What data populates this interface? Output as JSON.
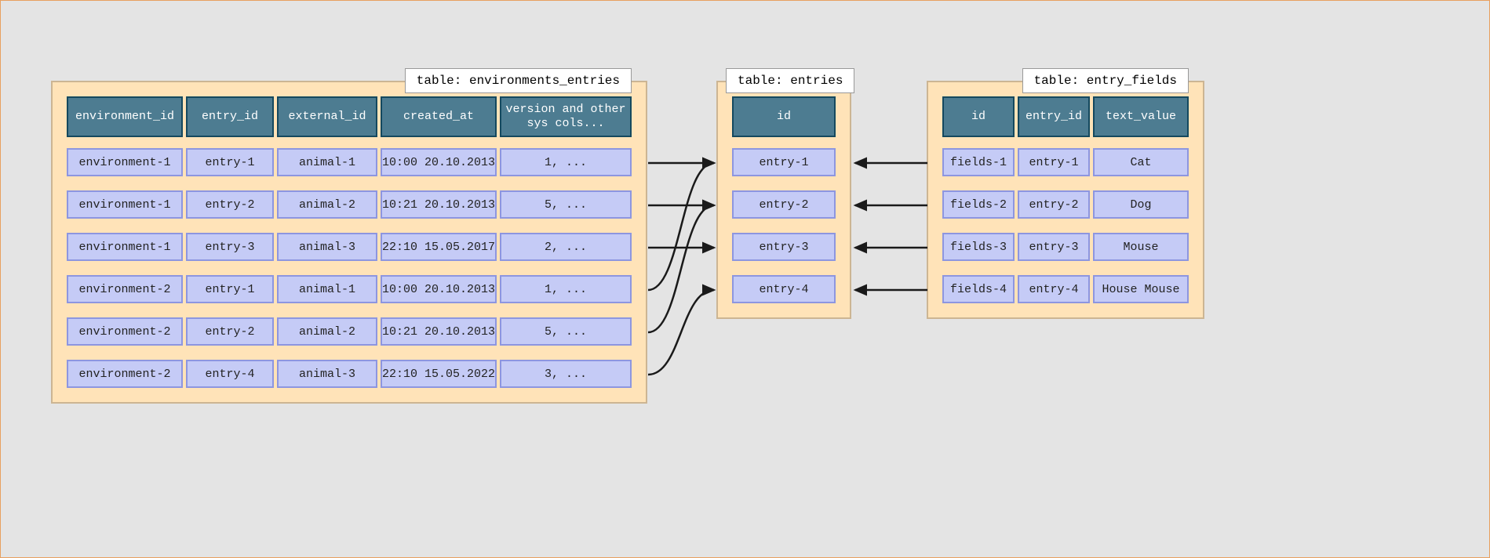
{
  "tables": {
    "environments_entries": {
      "label": "table: environments_entries",
      "headers": [
        "environment_id",
        "entry_id",
        "external_id",
        "created_at",
        "version and other sys cols..."
      ],
      "rows": [
        {
          "c0": "environment-1",
          "c1": "entry-1",
          "c2": "animal-1",
          "c3": "10:00 20.10.2013",
          "c4": "1, ..."
        },
        {
          "c0": "environment-1",
          "c1": "entry-2",
          "c2": "animal-2",
          "c3": "10:21 20.10.2013",
          "c4": "5, ..."
        },
        {
          "c0": "environment-1",
          "c1": "entry-3",
          "c2": "animal-3",
          "c3": "22:10 15.05.2017",
          "c4": "2, ..."
        },
        {
          "c0": "environment-2",
          "c1": "entry-1",
          "c2": "animal-1",
          "c3": "10:00 20.10.2013",
          "c4": "1, ..."
        },
        {
          "c0": "environment-2",
          "c1": "entry-2",
          "c2": "animal-2",
          "c3": "10:21 20.10.2013",
          "c4": "5, ..."
        },
        {
          "c0": "environment-2",
          "c1": "entry-4",
          "c2": "animal-3",
          "c3": "22:10 15.05.2022",
          "c4": "3, ..."
        }
      ]
    },
    "entries": {
      "label": "table: entries",
      "headers": [
        "id"
      ],
      "rows": [
        {
          "c0": "entry-1"
        },
        {
          "c0": "entry-2"
        },
        {
          "c0": "entry-3"
        },
        {
          "c0": "entry-4"
        }
      ]
    },
    "entry_fields": {
      "label": "table: entry_fields",
      "headers": [
        "id",
        "entry_id",
        "text_value"
      ],
      "rows": [
        {
          "c0": "fields-1",
          "c1": "entry-1",
          "c2": "Cat"
        },
        {
          "c0": "fields-2",
          "c1": "entry-2",
          "c2": "Dog"
        },
        {
          "c0": "fields-3",
          "c1": "entry-3",
          "c2": "Mouse"
        },
        {
          "c0": "fields-4",
          "c1": "entry-4",
          "c2": "House Mouse"
        }
      ]
    }
  },
  "relationships": {
    "left_to_middle": [
      {
        "from_row": 0,
        "to_row": 0
      },
      {
        "from_row": 1,
        "to_row": 1
      },
      {
        "from_row": 2,
        "to_row": 2
      },
      {
        "from_row": 3,
        "to_row": 0
      },
      {
        "from_row": 4,
        "to_row": 1
      },
      {
        "from_row": 5,
        "to_row": 3
      }
    ],
    "right_to_middle": [
      {
        "from_row": 0,
        "to_row": 0
      },
      {
        "from_row": 1,
        "to_row": 1
      },
      {
        "from_row": 2,
        "to_row": 2
      },
      {
        "from_row": 3,
        "to_row": 3
      }
    ]
  }
}
